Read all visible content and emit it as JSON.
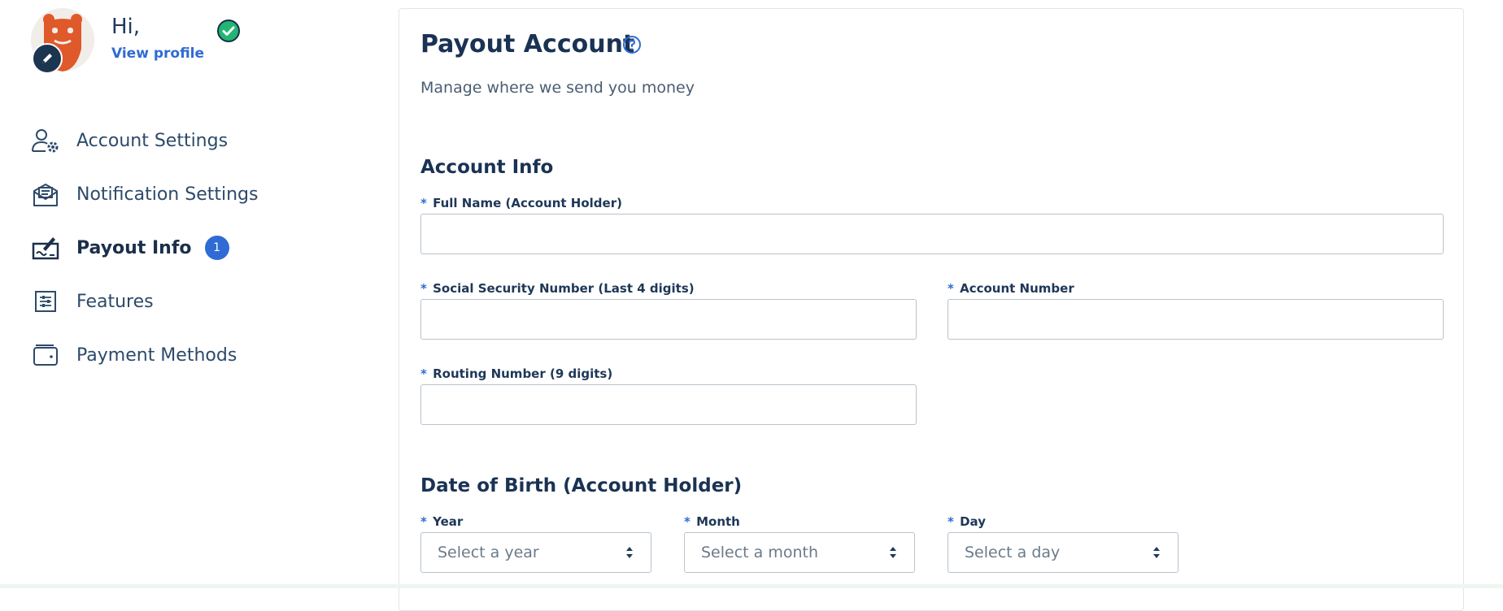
{
  "profile": {
    "greeting": "Hi,",
    "view_profile": "View profile"
  },
  "sidebar": {
    "items": [
      {
        "label": "Account Settings",
        "icon": "user-gear-icon"
      },
      {
        "label": "Notification Settings",
        "icon": "mail-notification-icon"
      },
      {
        "label": "Payout Info",
        "icon": "payout-check-icon",
        "badge": "1",
        "active": true
      },
      {
        "label": "Features",
        "icon": "sliders-icon"
      },
      {
        "label": "Payment Methods",
        "icon": "wallet-icon"
      }
    ]
  },
  "main": {
    "title": "Payout Account",
    "subtitle": "Manage where we send you money",
    "account_info": {
      "heading": "Account Info",
      "full_name_label": "Full Name (Account Holder)",
      "ssn_label": "Social Security Number (Last 4 digits)",
      "account_number_label": "Account Number",
      "routing_label": "Routing Number (9 digits)"
    },
    "dob": {
      "heading": "Date of Birth (Account Holder)",
      "year_label": "Year",
      "month_label": "Month",
      "day_label": "Day",
      "year_placeholder": "Select a year",
      "month_placeholder": "Select a month",
      "day_placeholder": "Select a day"
    },
    "required_marker": "*"
  },
  "colors": {
    "accent": "#2f6bd3",
    "heading": "#1a3253",
    "verified": "#22b573"
  }
}
